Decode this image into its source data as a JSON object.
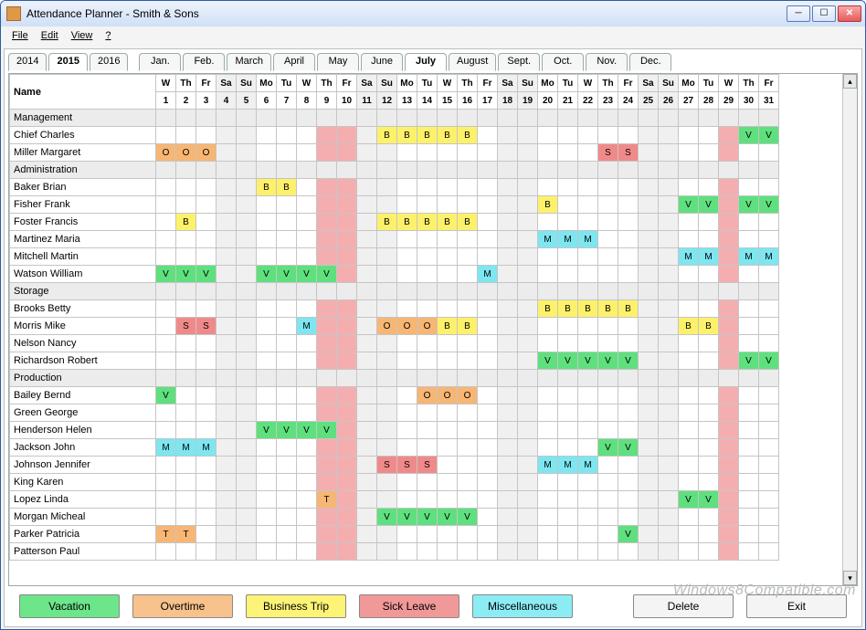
{
  "window": {
    "title": "Attendance Planner - Smith & Sons"
  },
  "menu": {
    "file": "File",
    "edit": "Edit",
    "view": "View",
    "help": "?"
  },
  "tabs": {
    "years": [
      "2014",
      "2015",
      "2016"
    ],
    "activeYear": "2015",
    "months": [
      "Jan.",
      "Feb.",
      "March",
      "April",
      "May",
      "June",
      "July",
      "August",
      "Sept.",
      "Oct.",
      "Nov.",
      "Dec."
    ],
    "activeMonth": "July"
  },
  "header": {
    "nameLabel": "Name",
    "days": [
      {
        "dow": "W",
        "num": "1"
      },
      {
        "dow": "Th",
        "num": "2"
      },
      {
        "dow": "Fr",
        "num": "3"
      },
      {
        "dow": "Sa",
        "num": "4",
        "wk": true
      },
      {
        "dow": "Su",
        "num": "5",
        "wk": true
      },
      {
        "dow": "Mo",
        "num": "6"
      },
      {
        "dow": "Tu",
        "num": "7"
      },
      {
        "dow": "W",
        "num": "8"
      },
      {
        "dow": "Th",
        "num": "9",
        "pink": true
      },
      {
        "dow": "Fr",
        "num": "10",
        "pink": true
      },
      {
        "dow": "Sa",
        "num": "11",
        "wk": true
      },
      {
        "dow": "Su",
        "num": "12",
        "wk": true
      },
      {
        "dow": "Mo",
        "num": "13"
      },
      {
        "dow": "Tu",
        "num": "14"
      },
      {
        "dow": "W",
        "num": "15"
      },
      {
        "dow": "Th",
        "num": "16"
      },
      {
        "dow": "Fr",
        "num": "17"
      },
      {
        "dow": "Sa",
        "num": "18",
        "wk": true
      },
      {
        "dow": "Su",
        "num": "19",
        "wk": true
      },
      {
        "dow": "Mo",
        "num": "20"
      },
      {
        "dow": "Tu",
        "num": "21"
      },
      {
        "dow": "W",
        "num": "22"
      },
      {
        "dow": "Th",
        "num": "23"
      },
      {
        "dow": "Fr",
        "num": "24"
      },
      {
        "dow": "Sa",
        "num": "25",
        "wk": true
      },
      {
        "dow": "Su",
        "num": "26",
        "wk": true
      },
      {
        "dow": "Mo",
        "num": "27"
      },
      {
        "dow": "Tu",
        "num": "28"
      },
      {
        "dow": "W",
        "num": "29",
        "pink": true
      },
      {
        "dow": "Th",
        "num": "30"
      },
      {
        "dow": "Fr",
        "num": "31"
      }
    ]
  },
  "rows": [
    {
      "group": true,
      "name": "Management"
    },
    {
      "name": "Chief Charles",
      "cells": {
        "12": "B",
        "13": "B",
        "14": "B",
        "15": "B",
        "16": "B",
        "30": "V",
        "31": "V"
      }
    },
    {
      "name": "Miller Margaret",
      "cells": {
        "1": "O",
        "2": "O",
        "3": "O",
        "23": "S",
        "24": "S"
      }
    },
    {
      "group": true,
      "name": "Administration"
    },
    {
      "name": "Baker Brian",
      "cells": {
        "6": "B",
        "7": "B"
      }
    },
    {
      "name": "Fisher Frank",
      "cells": {
        "20": "B",
        "27": "V",
        "28": "V",
        "30": "V",
        "31": "V"
      }
    },
    {
      "name": "Foster Francis",
      "cells": {
        "2": "B",
        "12": "B",
        "13": "B",
        "14": "B",
        "15": "B",
        "16": "B"
      }
    },
    {
      "name": "Martinez Maria",
      "cells": {
        "20": "M",
        "21": "M",
        "22": "M"
      }
    },
    {
      "name": "Mitchell Martin",
      "cells": {
        "27": "M",
        "28": "M",
        "30": "M",
        "31": "M"
      }
    },
    {
      "name": "Watson William",
      "cells": {
        "1": "V",
        "2": "V",
        "3": "V",
        "6": "V",
        "7": "V",
        "8": "V",
        "9": "V",
        "17": "M"
      }
    },
    {
      "group": true,
      "name": "Storage"
    },
    {
      "name": "Brooks Betty",
      "cells": {
        "20": "B",
        "21": "B",
        "22": "B",
        "23": "B",
        "24": "B"
      }
    },
    {
      "name": "Morris Mike",
      "cells": {
        "2": "S",
        "3": "S",
        "8": "M",
        "12": "O",
        "13": "O",
        "14": "O",
        "15": "B",
        "16": "B",
        "27": "B",
        "28": "B"
      }
    },
    {
      "name": "Nelson Nancy",
      "cells": {}
    },
    {
      "name": "Richardson Robert",
      "cells": {
        "20": "V",
        "21": "V",
        "22": "V",
        "23": "V",
        "24": "V",
        "30": "V",
        "31": "V"
      }
    },
    {
      "group": true,
      "name": "Production"
    },
    {
      "name": "Bailey Bernd",
      "cells": {
        "1": "V",
        "14": "O",
        "15": "O",
        "16": "O"
      }
    },
    {
      "name": "Green George",
      "cells": {}
    },
    {
      "name": "Henderson Helen",
      "cells": {
        "6": "V",
        "7": "V",
        "8": "V",
        "9": "V"
      }
    },
    {
      "name": "Jackson John",
      "cells": {
        "1": "M",
        "2": "M",
        "3": "M",
        "23": "V",
        "24": "V"
      }
    },
    {
      "name": "Johnson Jennifer",
      "cells": {
        "12": "S",
        "13": "S",
        "14": "S",
        "20": "M",
        "21": "M",
        "22": "M"
      }
    },
    {
      "name": "King Karen",
      "cells": {}
    },
    {
      "name": "Lopez Linda",
      "cells": {
        "9": "T",
        "27": "V",
        "28": "V"
      }
    },
    {
      "name": "Morgan Micheal",
      "cells": {
        "12": "V",
        "13": "V",
        "14": "V",
        "15": "V",
        "16": "V"
      }
    },
    {
      "name": "Parker Patricia",
      "cells": {
        "1": "T",
        "2": "T",
        "24": "V"
      }
    },
    {
      "name": "Patterson Paul",
      "cells": {}
    }
  ],
  "buttons": {
    "vacation": "Vacation",
    "overtime": "Overtime",
    "business": "Business Trip",
    "sick": "Sick Leave",
    "misc": "Miscellaneous",
    "delete": "Delete",
    "exit": "Exit"
  },
  "watermark": "Windows8Compatible.com"
}
